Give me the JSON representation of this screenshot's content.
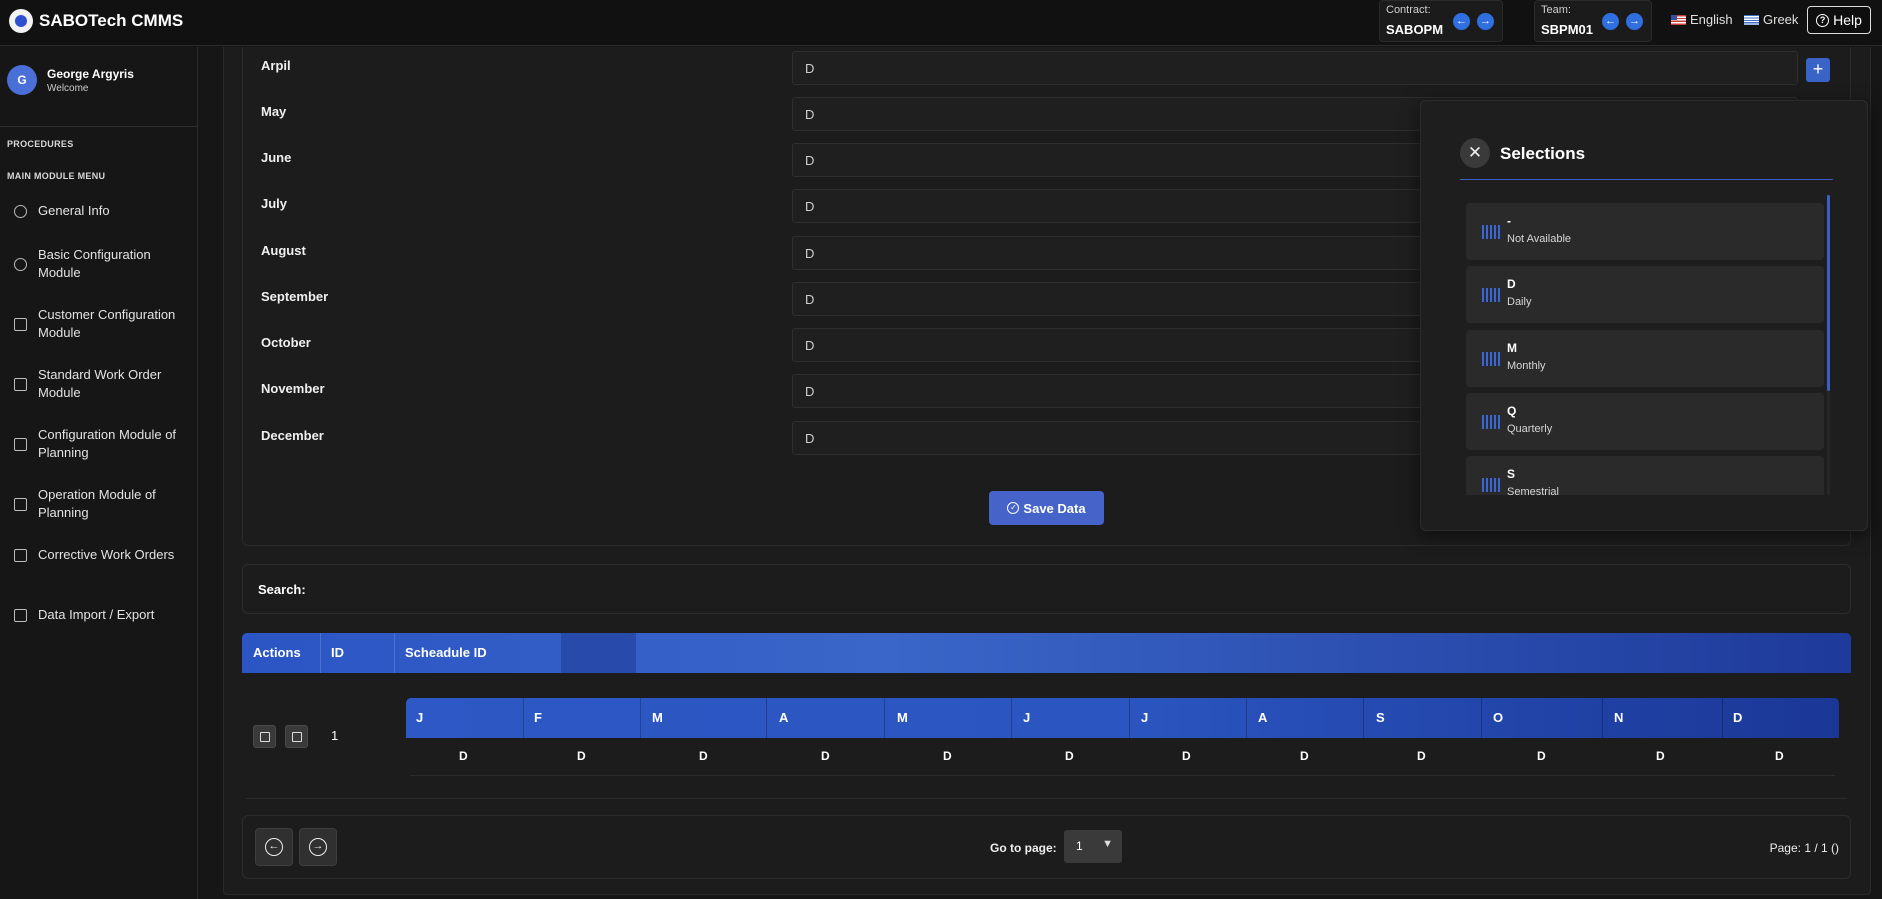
{
  "app": {
    "title": "SABOTech CMMS"
  },
  "header": {
    "contract_label": "Contract:",
    "contract_value": "SABOPM",
    "team_label": "Team:",
    "team_value": "SBPM01",
    "lang_en": "English",
    "lang_gr": "Greek",
    "help": "Help"
  },
  "user": {
    "initial": "G",
    "name": "George Argyris",
    "welcome": "Welcome"
  },
  "sidebar": {
    "section_procedures": "PROCEDURES",
    "section_main": "MAIN MODULE MENU",
    "items": [
      {
        "label": "General Info",
        "icon": "info-icon"
      },
      {
        "label": "Basic Configuration Module",
        "icon": "gear-icon"
      },
      {
        "label": "Customer Configuration Module",
        "icon": "sliders-icon"
      },
      {
        "label": "Standard Work Order Module",
        "icon": "clipboard-icon"
      },
      {
        "label": "Configuration Module of Planning",
        "icon": "calendar-grid-icon"
      },
      {
        "label": "Operation Module of Planning",
        "icon": "calendar-icon"
      },
      {
        "label": "Corrective Work Orders",
        "icon": "list-icon"
      },
      {
        "label": "Data Import / Export",
        "icon": "database-icon"
      }
    ]
  },
  "form": {
    "months": [
      {
        "label": "Arpil",
        "value": "D"
      },
      {
        "label": "May",
        "value": "D"
      },
      {
        "label": "June",
        "value": "D"
      },
      {
        "label": "July",
        "value": "D"
      },
      {
        "label": "August",
        "value": "D"
      },
      {
        "label": "September",
        "value": "D"
      },
      {
        "label": "October",
        "value": "D"
      },
      {
        "label": "November",
        "value": "D"
      },
      {
        "label": "December",
        "value": "D"
      }
    ],
    "add_symbol": "+",
    "save_label": "Save Data"
  },
  "search": {
    "label": "Search:"
  },
  "table": {
    "headers": {
      "actions": "Actions",
      "id": "ID",
      "schedule_id": "Scheadule ID"
    },
    "row": {
      "id": "1",
      "schedule_heads": [
        "J",
        "F",
        "M",
        "A",
        "M",
        "J",
        "J",
        "A",
        "S",
        "O",
        "N",
        "D"
      ],
      "schedule_values": [
        "D",
        "D",
        "D",
        "D",
        "D",
        "D",
        "D",
        "D",
        "D",
        "D",
        "D",
        "D"
      ]
    }
  },
  "pagination": {
    "goto_label": "Go to page:",
    "page_value": "1",
    "page_info": "Page: 1 / 1 ()"
  },
  "selections": {
    "title": "Selections",
    "items": [
      {
        "code": "-",
        "desc": "Not Available"
      },
      {
        "code": "D",
        "desc": "Daily"
      },
      {
        "code": "M",
        "desc": "Monthly"
      },
      {
        "code": "Q",
        "desc": "Quarterly"
      },
      {
        "code": "S",
        "desc": "Semestrial"
      }
    ]
  },
  "colors": {
    "accent": "#3a63c8",
    "background": "#161616"
  }
}
